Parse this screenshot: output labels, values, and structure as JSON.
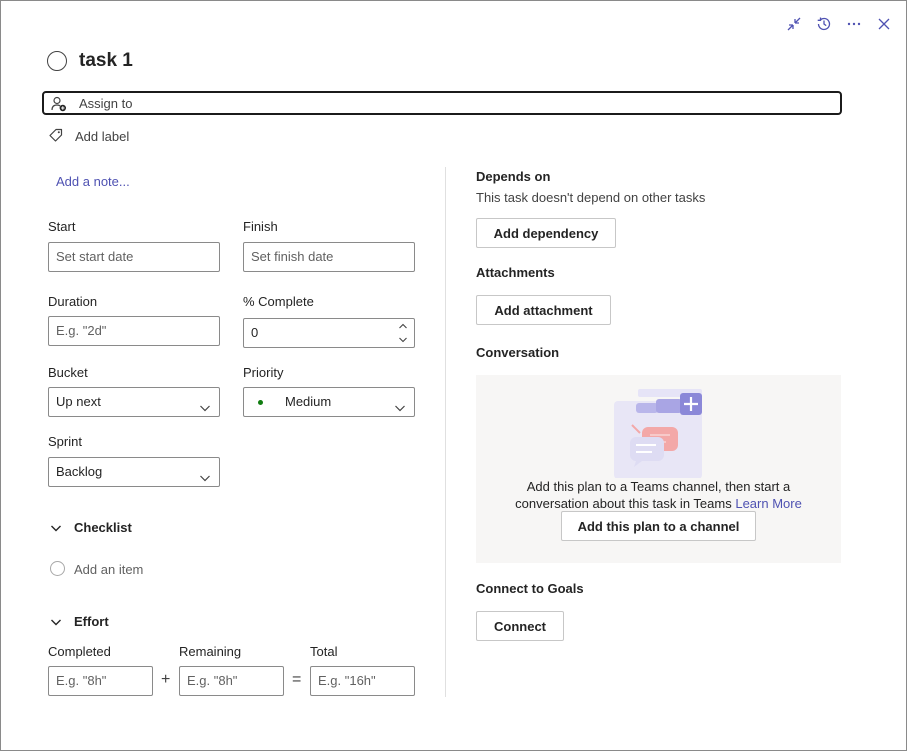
{
  "header": {
    "buttons": [
      {
        "name": "minimize-icon"
      },
      {
        "name": "history-icon"
      },
      {
        "name": "more-icon"
      },
      {
        "name": "close-icon"
      }
    ]
  },
  "task": {
    "title": "task 1"
  },
  "assign": {
    "placeholder": "Assign to"
  },
  "label": {
    "text": "Add label"
  },
  "note": {
    "link": "Add a note..."
  },
  "fields": {
    "start": {
      "label": "Start",
      "placeholder": "Set start date"
    },
    "finish": {
      "label": "Finish",
      "placeholder": "Set finish date"
    },
    "duration": {
      "label": "Duration",
      "placeholder": "E.g. \"2d\""
    },
    "percent_complete": {
      "label": "% Complete",
      "value": "0"
    },
    "bucket": {
      "label": "Bucket",
      "value": "Up next"
    },
    "priority": {
      "label": "Priority",
      "value": "Medium",
      "dot_color": "#107c10"
    },
    "sprint": {
      "label": "Sprint",
      "value": "Backlog"
    }
  },
  "checklist": {
    "title": "Checklist",
    "add_item": "Add an item"
  },
  "effort": {
    "title": "Effort",
    "completed": {
      "label": "Completed",
      "placeholder": "E.g. \"8h\""
    },
    "remaining": {
      "label": "Remaining",
      "placeholder": "E.g. \"8h\""
    },
    "total": {
      "label": "Total",
      "placeholder": "E.g. \"16h\""
    },
    "plus": "+",
    "equals": "="
  },
  "depends": {
    "title": "Depends on",
    "subtitle": "This task doesn't depend on other tasks",
    "button": "Add dependency"
  },
  "attachments": {
    "title": "Attachments",
    "button": "Add attachment"
  },
  "conversation": {
    "title": "Conversation",
    "line1": "Add this plan to a Teams channel, then start a",
    "line2": "conversation about this task in Teams",
    "learn_more": "Learn More",
    "button": "Add this plan to a channel"
  },
  "goals": {
    "title": "Connect to Goals",
    "button": "Connect"
  },
  "colors": {
    "accent": "#4f52b2",
    "text": "#242424",
    "illustration_purple": "#8b88d8"
  }
}
